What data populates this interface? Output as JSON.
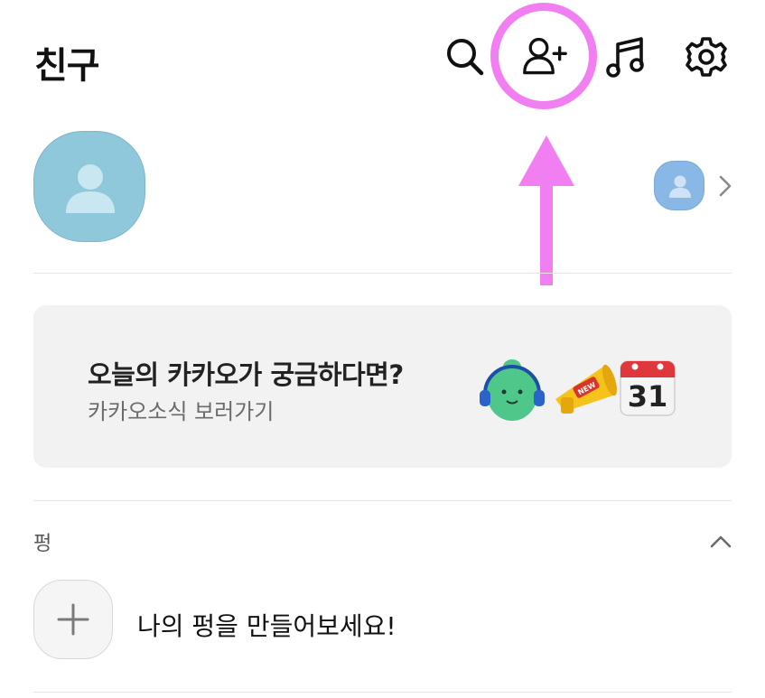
{
  "header": {
    "title": "친구",
    "icons": [
      "search-icon",
      "add-friend-icon",
      "music-icon",
      "settings-icon"
    ]
  },
  "profile": {
    "name": "",
    "avatar_color": "#8fc8db",
    "small_avatar_color": "#8ab8e6"
  },
  "banner": {
    "title": "오늘의 카카오가 궁금하다면?",
    "subtitle": "카카오소식 보러가기",
    "background": "#f2f2f2",
    "calendar_day": "31",
    "megaphone_badge": "NEW"
  },
  "section": {
    "label": "펑",
    "add_prompt": "나의 펑을 만들어보세요!"
  },
  "annotation": {
    "color": "#f27ff2"
  }
}
